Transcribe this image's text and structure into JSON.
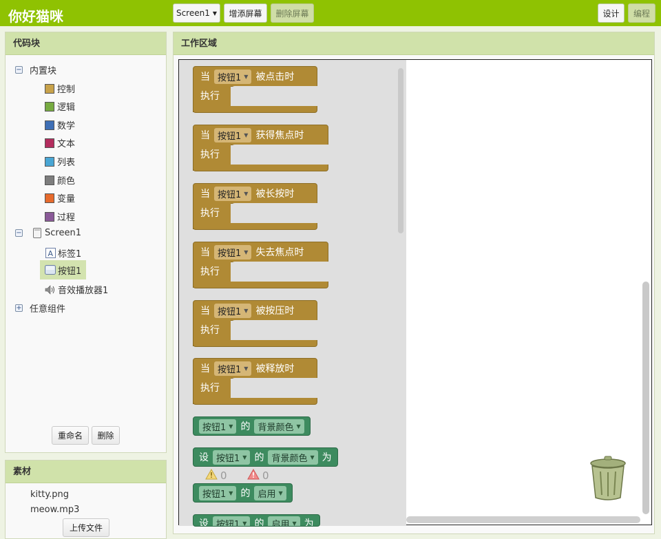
{
  "app": {
    "title": "你好猫咪"
  },
  "toolbar": {
    "screen_select": "Screen1",
    "add_screen": "增添屏幕",
    "remove_screen": "删除屏幕",
    "designer": "设计",
    "blocks": "编程"
  },
  "blocks_panel": {
    "title": "代码块",
    "builtin": {
      "label": "内置块",
      "items": [
        {
          "label": "控制",
          "color": "#c8a24a"
        },
        {
          "label": "逻辑",
          "color": "#77ab41"
        },
        {
          "label": "数学",
          "color": "#3f6fb5"
        },
        {
          "label": "文本",
          "color": "#b32d5e"
        },
        {
          "label": "列表",
          "color": "#49a6d4"
        },
        {
          "label": "颜色",
          "color": "#7d7d7d"
        },
        {
          "label": "变量",
          "color": "#e66a2c"
        },
        {
          "label": "过程",
          "color": "#8a5a98"
        }
      ]
    },
    "screen": {
      "label": "Screen1",
      "components": [
        {
          "label": "标签1",
          "icon": "label-icon"
        },
        {
          "label": "按钮1",
          "icon": "button-icon"
        },
        {
          "label": "音效播放器1",
          "icon": "sound-icon"
        }
      ]
    },
    "any_component": "任意组件",
    "rename": "重命名",
    "delete": "删除"
  },
  "media_panel": {
    "title": "素材",
    "files": [
      "kitty.png",
      "meow.mp3"
    ],
    "upload": "上传文件"
  },
  "workspace": {
    "title": "工作区域",
    "event_blocks": [
      {
        "when": "当",
        "component": "按钮1",
        "event": "被点击时",
        "do": "执行"
      },
      {
        "when": "当",
        "component": "按钮1",
        "event": "获得焦点时",
        "do": "执行"
      },
      {
        "when": "当",
        "component": "按钮1",
        "event": "被长按时",
        "do": "执行"
      },
      {
        "when": "当",
        "component": "按钮1",
        "event": "失去焦点时",
        "do": "执行"
      },
      {
        "when": "当",
        "component": "按钮1",
        "event": "被按压时",
        "do": "执行"
      },
      {
        "when": "当",
        "component": "按钮1",
        "event": "被释放时",
        "do": "执行"
      }
    ],
    "getter_bg": {
      "component": "按钮1",
      "of": "的",
      "property": "背景颜色"
    },
    "setter_bg": {
      "set": "设",
      "component": "按钮1",
      "of": "的",
      "property": "背景颜色",
      "to": "为"
    },
    "getter_enabled": {
      "component": "按钮1",
      "of": "的",
      "property": "启用"
    },
    "setter_enabled": {
      "set": "设",
      "component": "按钮1",
      "of": "的",
      "property": "启用",
      "to": "为"
    },
    "warnings": "0",
    "errors": "0"
  }
}
